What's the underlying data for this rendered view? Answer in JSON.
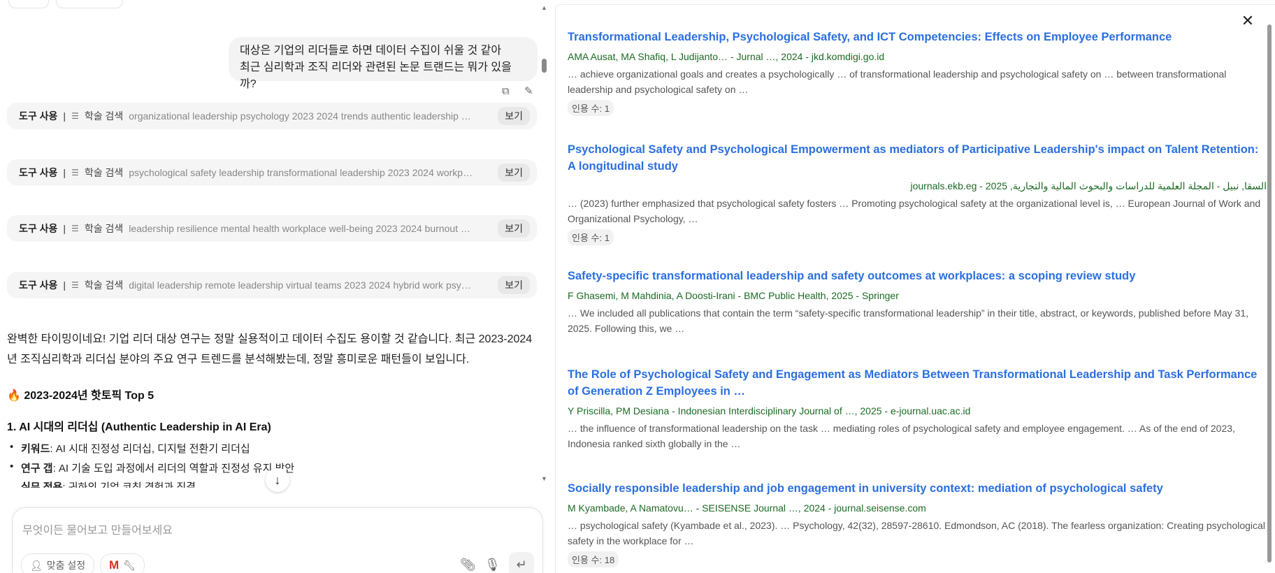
{
  "chat": {
    "user_message_lines": [
      "대상은 기업의 리더들로 하면 데이터 수집이 쉬울 것 같아",
      "최근 심리학과 조직 리더와 관련된 논문 트랜드는 뭐가 있을까?"
    ],
    "tool_calls": [
      {
        "label": "도구 사용",
        "kind": "학술 검색",
        "query": "organizational leadership psychology 2023 2024 trends authentic leadership …",
        "view": "보기"
      },
      {
        "label": "도구 사용",
        "kind": "학술 검색",
        "query": "psychological safety leadership transformational leadership 2023 2024 workp…",
        "view": "보기"
      },
      {
        "label": "도구 사용",
        "kind": "학술 검색",
        "query": "leadership resilience mental health workplace well-being 2023 2024 burnout …",
        "view": "보기"
      },
      {
        "label": "도구 사용",
        "kind": "학술 검색",
        "query": "digital leadership remote leadership virtual teams 2023 2024 hybrid work psy…",
        "view": "보기"
      }
    ],
    "response_paragraph": "완벽한 타이밍이네요! 기업 리더 대상 연구는 정말 실용적이고 데이터 수집도 용이할 것 같습니다. 최근 2023-2024년 조직심리학과 리더십 분야의 주요 연구 트렌드를 분석해봤는데, 정말 흥미로운 패턴들이 보입니다.",
    "hot_heading": "🔥 2023-2024년 핫토픽 Top 5",
    "section1_title": "1. AI 시대의 리더십 (Authentic Leadership in AI Era)",
    "bullets": [
      {
        "key": "키워드",
        "text": ": AI 시대 진정성 리더십, 디지털 전환기 리더십"
      },
      {
        "key": "연구 갭",
        "text": ": AI 기술 도입 과정에서 리더의 역할과 진정성 유지 방안"
      },
      {
        "key": "실무 적용",
        "text": ": 귀하의 기업 코칭 경험과 직결"
      }
    ],
    "input_placeholder": "무엇이든 물어보고 만들어보세요",
    "personalize_label": "맞춤 설정"
  },
  "results_panel": {
    "results": [
      {
        "title": "Transformational Leadership, Psychological Safety, and ICT Competencies: Effects on Employee Performance",
        "meta": "AMA Ausat, MA Shafiq, L Judijanto… - Jurnal …, 2024 - jkd.komdigi.go.id",
        "snippet": "… achieve organizational goals and creates a psychologically … of transformational leadership and psychological safety on … between transformational leadership and psychological safety on …",
        "citations": "인용 수: 1"
      },
      {
        "title": "Psychological Safety and Psychological Empowerment as mediators of Participative Leadership's impact on Talent Retention: A longitudinal study",
        "meta": "السقا, نبيل - المجلة العلمية للدراسات والبحوث المالية والتجارية, 2025 - journals.ekb.eg",
        "snippet": "… (2023) further emphasized that psychological safety fosters … Promoting psychological safety at the organizational level is, … European Journal of Work and Organizational Psychology, …",
        "citations": "인용 수: 1"
      },
      {
        "title": "Safety-specific transformational leadership and safety outcomes at workplaces: a scoping review study",
        "meta": "F Ghasemi, M Mahdinia, A Doosti-Irani - BMC Public Health, 2025 - Springer",
        "snippet": "… We included all publications that contain the term “safety-specific transformational leadership” in their title, abstract, or keywords, published before May 31, 2025. Following this, we …",
        "citations": null
      },
      {
        "title": "The Role of Psychological Safety and Engagement as Mediators Between Transformational Leadership and Task Performance of Generation Z Employees in …",
        "meta": "Y Priscilla, PM Desiana - Indonesian Interdisciplinary Journal of …, 2025 - e-journal.uac.ac.id",
        "snippet": "… the influence of transformational leadership on the task … mediating roles of psychological safety and employee engagement. … As of the end of 2023, Indonesia ranked sixth globally in the …",
        "citations": null
      },
      {
        "title": "Socially responsible leadership and job engagement in university context: mediation of psychological safety",
        "meta": "M Kyambade, A Namatovu… - SEISENSE Journal …, 2024 - journal.seisense.com",
        "snippet": "… psychological safety (Kyambade et al., 2023). … Psychology, 42(32), 28597-28610. Edmondson, AC (2018). The fearless organization: Creating psychological safety in the workplace for …",
        "citations": "인용 수: 18"
      }
    ]
  },
  "colors": {
    "link": "#2b6fe0",
    "meta": "#1c6b24"
  }
}
